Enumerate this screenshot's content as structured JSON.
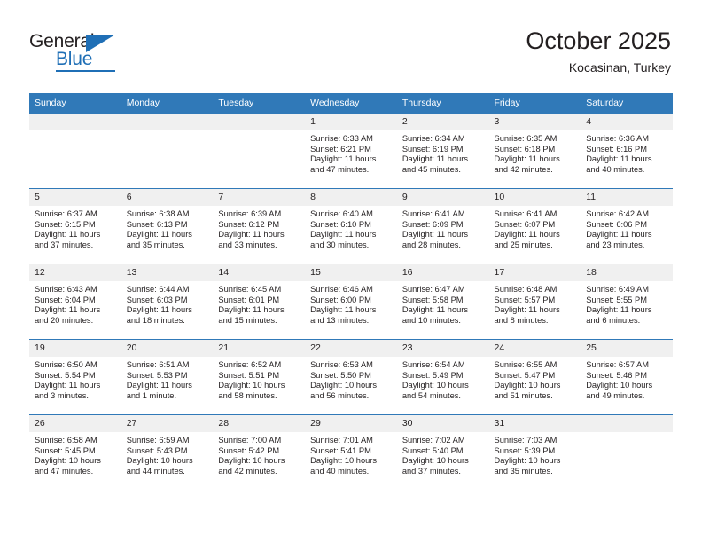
{
  "logo": {
    "word_one": "General",
    "word_two": "Blue",
    "triangle_icon": "triangle-icon"
  },
  "header": {
    "title": "October 2025",
    "subtitle": "Kocasinan, Turkey"
  },
  "colors": {
    "header_blue": "#3079b8",
    "brand_blue": "#1f6fb6",
    "daynum_bg": "#f0f0f0",
    "text": "#231f20"
  },
  "weekday_headers": [
    "Sunday",
    "Monday",
    "Tuesday",
    "Wednesday",
    "Thursday",
    "Friday",
    "Saturday"
  ],
  "weeks": [
    [
      {
        "day": "",
        "lines": []
      },
      {
        "day": "",
        "lines": []
      },
      {
        "day": "",
        "lines": []
      },
      {
        "day": "1",
        "lines": [
          "Sunrise: 6:33 AM",
          "Sunset: 6:21 PM",
          "Daylight: 11 hours",
          "and 47 minutes."
        ]
      },
      {
        "day": "2",
        "lines": [
          "Sunrise: 6:34 AM",
          "Sunset: 6:19 PM",
          "Daylight: 11 hours",
          "and 45 minutes."
        ]
      },
      {
        "day": "3",
        "lines": [
          "Sunrise: 6:35 AM",
          "Sunset: 6:18 PM",
          "Daylight: 11 hours",
          "and 42 minutes."
        ]
      },
      {
        "day": "4",
        "lines": [
          "Sunrise: 6:36 AM",
          "Sunset: 6:16 PM",
          "Daylight: 11 hours",
          "and 40 minutes."
        ]
      }
    ],
    [
      {
        "day": "5",
        "lines": [
          "Sunrise: 6:37 AM",
          "Sunset: 6:15 PM",
          "Daylight: 11 hours",
          "and 37 minutes."
        ]
      },
      {
        "day": "6",
        "lines": [
          "Sunrise: 6:38 AM",
          "Sunset: 6:13 PM",
          "Daylight: 11 hours",
          "and 35 minutes."
        ]
      },
      {
        "day": "7",
        "lines": [
          "Sunrise: 6:39 AM",
          "Sunset: 6:12 PM",
          "Daylight: 11 hours",
          "and 33 minutes."
        ]
      },
      {
        "day": "8",
        "lines": [
          "Sunrise: 6:40 AM",
          "Sunset: 6:10 PM",
          "Daylight: 11 hours",
          "and 30 minutes."
        ]
      },
      {
        "day": "9",
        "lines": [
          "Sunrise: 6:41 AM",
          "Sunset: 6:09 PM",
          "Daylight: 11 hours",
          "and 28 minutes."
        ]
      },
      {
        "day": "10",
        "lines": [
          "Sunrise: 6:41 AM",
          "Sunset: 6:07 PM",
          "Daylight: 11 hours",
          "and 25 minutes."
        ]
      },
      {
        "day": "11",
        "lines": [
          "Sunrise: 6:42 AM",
          "Sunset: 6:06 PM",
          "Daylight: 11 hours",
          "and 23 minutes."
        ]
      }
    ],
    [
      {
        "day": "12",
        "lines": [
          "Sunrise: 6:43 AM",
          "Sunset: 6:04 PM",
          "Daylight: 11 hours",
          "and 20 minutes."
        ]
      },
      {
        "day": "13",
        "lines": [
          "Sunrise: 6:44 AM",
          "Sunset: 6:03 PM",
          "Daylight: 11 hours",
          "and 18 minutes."
        ]
      },
      {
        "day": "14",
        "lines": [
          "Sunrise: 6:45 AM",
          "Sunset: 6:01 PM",
          "Daylight: 11 hours",
          "and 15 minutes."
        ]
      },
      {
        "day": "15",
        "lines": [
          "Sunrise: 6:46 AM",
          "Sunset: 6:00 PM",
          "Daylight: 11 hours",
          "and 13 minutes."
        ]
      },
      {
        "day": "16",
        "lines": [
          "Sunrise: 6:47 AM",
          "Sunset: 5:58 PM",
          "Daylight: 11 hours",
          "and 10 minutes."
        ]
      },
      {
        "day": "17",
        "lines": [
          "Sunrise: 6:48 AM",
          "Sunset: 5:57 PM",
          "Daylight: 11 hours",
          "and 8 minutes."
        ]
      },
      {
        "day": "18",
        "lines": [
          "Sunrise: 6:49 AM",
          "Sunset: 5:55 PM",
          "Daylight: 11 hours",
          "and 6 minutes."
        ]
      }
    ],
    [
      {
        "day": "19",
        "lines": [
          "Sunrise: 6:50 AM",
          "Sunset: 5:54 PM",
          "Daylight: 11 hours",
          "and 3 minutes."
        ]
      },
      {
        "day": "20",
        "lines": [
          "Sunrise: 6:51 AM",
          "Sunset: 5:53 PM",
          "Daylight: 11 hours",
          "and 1 minute."
        ]
      },
      {
        "day": "21",
        "lines": [
          "Sunrise: 6:52 AM",
          "Sunset: 5:51 PM",
          "Daylight: 10 hours",
          "and 58 minutes."
        ]
      },
      {
        "day": "22",
        "lines": [
          "Sunrise: 6:53 AM",
          "Sunset: 5:50 PM",
          "Daylight: 10 hours",
          "and 56 minutes."
        ]
      },
      {
        "day": "23",
        "lines": [
          "Sunrise: 6:54 AM",
          "Sunset: 5:49 PM",
          "Daylight: 10 hours",
          "and 54 minutes."
        ]
      },
      {
        "day": "24",
        "lines": [
          "Sunrise: 6:55 AM",
          "Sunset: 5:47 PM",
          "Daylight: 10 hours",
          "and 51 minutes."
        ]
      },
      {
        "day": "25",
        "lines": [
          "Sunrise: 6:57 AM",
          "Sunset: 5:46 PM",
          "Daylight: 10 hours",
          "and 49 minutes."
        ]
      }
    ],
    [
      {
        "day": "26",
        "lines": [
          "Sunrise: 6:58 AM",
          "Sunset: 5:45 PM",
          "Daylight: 10 hours",
          "and 47 minutes."
        ]
      },
      {
        "day": "27",
        "lines": [
          "Sunrise: 6:59 AM",
          "Sunset: 5:43 PM",
          "Daylight: 10 hours",
          "and 44 minutes."
        ]
      },
      {
        "day": "28",
        "lines": [
          "Sunrise: 7:00 AM",
          "Sunset: 5:42 PM",
          "Daylight: 10 hours",
          "and 42 minutes."
        ]
      },
      {
        "day": "29",
        "lines": [
          "Sunrise: 7:01 AM",
          "Sunset: 5:41 PM",
          "Daylight: 10 hours",
          "and 40 minutes."
        ]
      },
      {
        "day": "30",
        "lines": [
          "Sunrise: 7:02 AM",
          "Sunset: 5:40 PM",
          "Daylight: 10 hours",
          "and 37 minutes."
        ]
      },
      {
        "day": "31",
        "lines": [
          "Sunrise: 7:03 AM",
          "Sunset: 5:39 PM",
          "Daylight: 10 hours",
          "and 35 minutes."
        ]
      },
      {
        "day": "",
        "lines": []
      }
    ]
  ]
}
